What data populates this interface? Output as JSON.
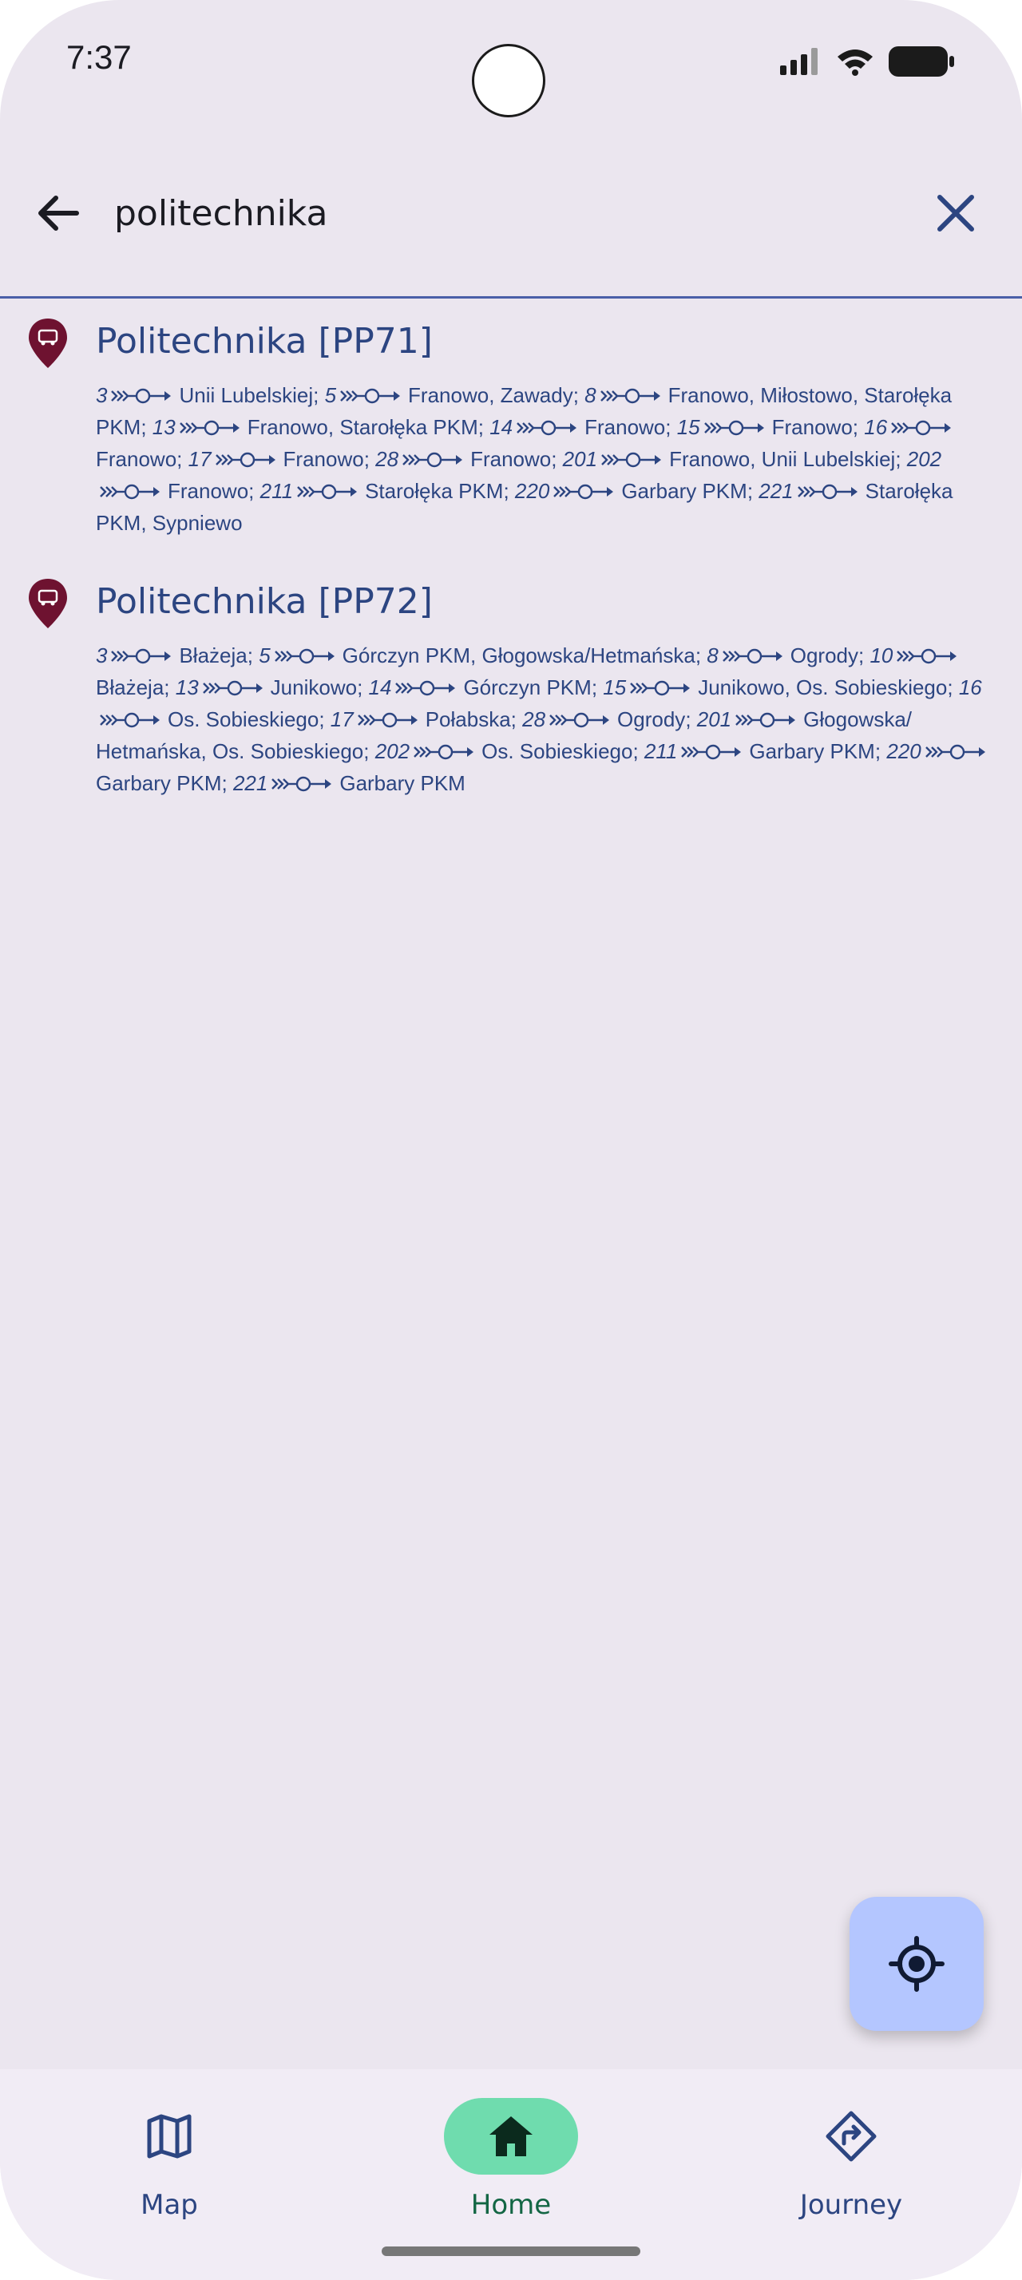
{
  "status": {
    "time": "7:37"
  },
  "search": {
    "value": "politechnika",
    "placeholder": ""
  },
  "results": [
    {
      "name": "Politechnika [PP71]",
      "lines": [
        {
          "no": "3",
          "dest": "Unii Lubelskiej"
        },
        {
          "no": "5",
          "dest": "Franowo, Zawady"
        },
        {
          "no": "8",
          "dest": "Franowo, Miłostowo, Starołęka PKM"
        },
        {
          "no": "13",
          "dest": "Franowo, Starołęka PKM"
        },
        {
          "no": "14",
          "dest": "Franowo"
        },
        {
          "no": "15",
          "dest": "Franowo"
        },
        {
          "no": "16",
          "dest": "Franowo"
        },
        {
          "no": "17",
          "dest": "Franowo"
        },
        {
          "no": "28",
          "dest": "Franowo"
        },
        {
          "no": "201",
          "dest": "Franowo, Unii Lubelskiej"
        },
        {
          "no": "202",
          "dest": "Franowo"
        },
        {
          "no": "211",
          "dest": "Starołęka PKM"
        },
        {
          "no": "220",
          "dest": "Garbary PKM"
        },
        {
          "no": "221",
          "dest": "Starołęka PKM, Sypniewo"
        }
      ]
    },
    {
      "name": "Politechnika [PP72]",
      "lines": [
        {
          "no": "3",
          "dest": "Błażeja"
        },
        {
          "no": "5",
          "dest": "Górczyn PKM, Głogowska/Hetmańska"
        },
        {
          "no": "8",
          "dest": "Ogrody"
        },
        {
          "no": "10",
          "dest": "Błażeja"
        },
        {
          "no": "13",
          "dest": "Junikowo"
        },
        {
          "no": "14",
          "dest": "Górczyn PKM"
        },
        {
          "no": "15",
          "dest": "Junikowo, Os. Sobieskiego"
        },
        {
          "no": "16",
          "dest": "Os. Sobieskiego"
        },
        {
          "no": "17",
          "dest": "Połabska"
        },
        {
          "no": "28",
          "dest": "Ogrody"
        },
        {
          "no": "201",
          "dest": "Głogowska/ Hetmańska, Os. Sobieskiego"
        },
        {
          "no": "202",
          "dest": "Os. Sobieskiego"
        },
        {
          "no": "211",
          "dest": "Garbary PKM"
        },
        {
          "no": "220",
          "dest": "Garbary PKM"
        },
        {
          "no": "221",
          "dest": "Garbary PKM"
        }
      ]
    }
  ],
  "nav": {
    "items": [
      {
        "label": "Map",
        "icon": "map-icon",
        "active": false
      },
      {
        "label": "Home",
        "icon": "home-icon",
        "active": true
      },
      {
        "label": "Journey",
        "icon": "directions-icon",
        "active": false
      }
    ]
  },
  "colors": {
    "background": "#ebe6ef",
    "text": "#2c4581",
    "pin": "#6e1230",
    "fab": "#b4c6ff",
    "active_pill": "#6fdcae",
    "active_label": "#136644"
  }
}
